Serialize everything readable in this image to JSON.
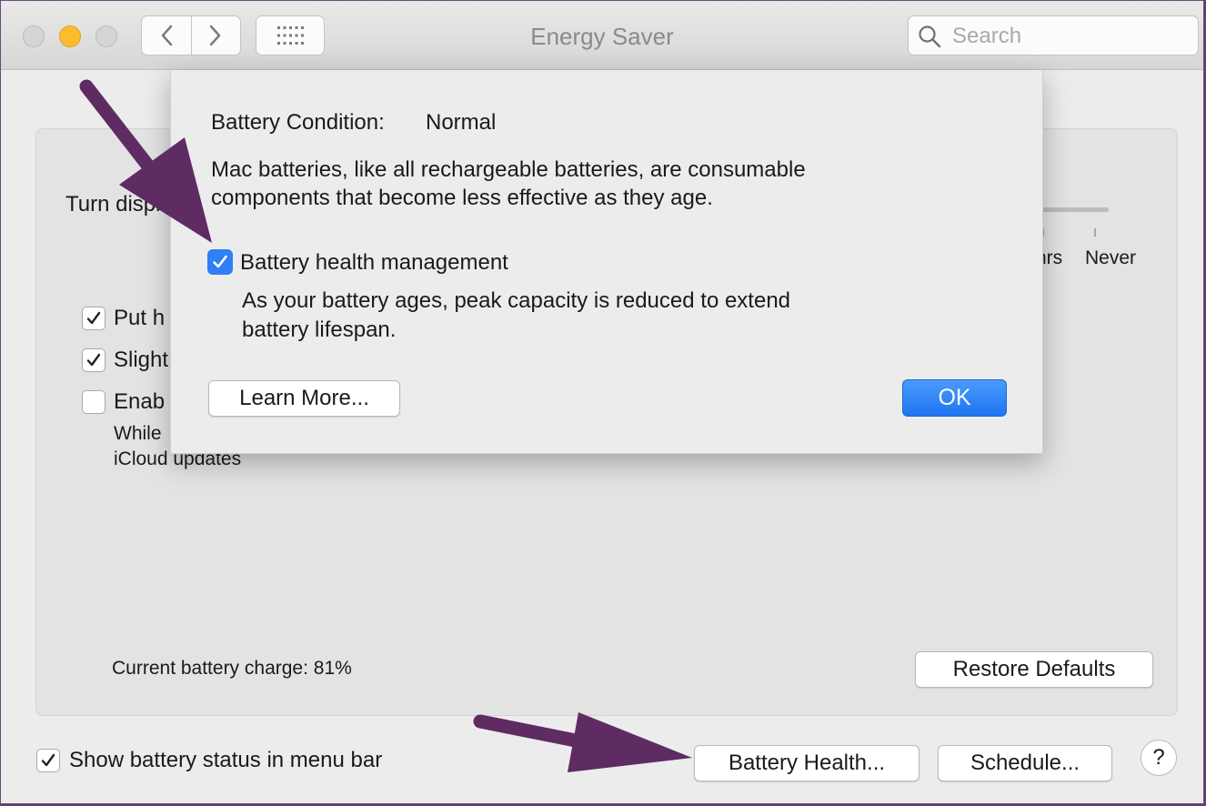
{
  "window": {
    "title": "Energy Saver",
    "search_placeholder": "Search"
  },
  "panel": {
    "turn_display_label": "Turn displ",
    "slider_tick_hrs": "hrs",
    "slider_tick_never": "Never",
    "options": [
      {
        "label": "Put h",
        "checked": true
      },
      {
        "label": "Slight",
        "checked": true
      },
      {
        "label": "Enab",
        "checked": false
      }
    ],
    "option_description_line1": "While",
    "option_description_line2": "iCloud updates",
    "battery_charge": "Current battery charge: 81%",
    "restore_defaults": "Restore Defaults"
  },
  "footer": {
    "show_battery_status": "Show battery status in menu bar",
    "show_battery_status_checked": true,
    "battery_health_button": "Battery Health...",
    "schedule_button": "Schedule...",
    "help": "?"
  },
  "sheet": {
    "condition_label": "Battery Condition:",
    "condition_value": "Normal",
    "description_line1": "Mac batteries, like all rechargeable batteries, are consumable",
    "description_line2": "components that become less effective as they age.",
    "management_label": "Battery health management",
    "management_checked": true,
    "management_desc_line1": "As your battery ages, peak capacity is reduced to extend",
    "management_desc_line2": "battery lifespan.",
    "learn_more": "Learn More...",
    "ok": "OK"
  },
  "colors": {
    "annotation_arrow": "#5e2b63",
    "accent_blue": "#2f7ff5",
    "minimize_yellow": "#fbbd2e"
  }
}
